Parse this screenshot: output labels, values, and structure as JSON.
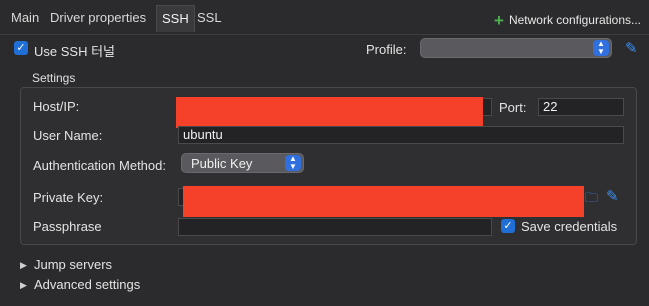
{
  "tabs": [
    "Main",
    "Driver properties",
    "SSH",
    "SSL"
  ],
  "network_configurations_label": "Network configurations...",
  "use_ssh_tunnel_label": "Use SSH 터널",
  "profile_label": "Profile:",
  "profile_value": "",
  "settings_title": "Settings",
  "host_label": "Host/IP:",
  "port_label": "Port:",
  "port_value": "22",
  "username_label": "User Name:",
  "username_value": "ubuntu",
  "auth_method_label": "Authentication Method:",
  "auth_method_value": "Public Key",
  "private_key_label": "Private Key:",
  "passphrase_label": "Passphrase",
  "save_credentials_label": "Save credentials",
  "save_credentials_checked": true,
  "use_ssh_checked": true,
  "jump_servers_label": "Jump servers",
  "advanced_settings_label": "Advanced settings",
  "colors": {
    "accent": "#2f6fde",
    "redaction": "#f5402a",
    "add_icon": "#4caf50"
  },
  "icons": [
    "plus-icon",
    "checkmark-icon",
    "chevron-updown-icon",
    "pencil-icon",
    "folder-icon",
    "triangle-right-icon"
  ]
}
